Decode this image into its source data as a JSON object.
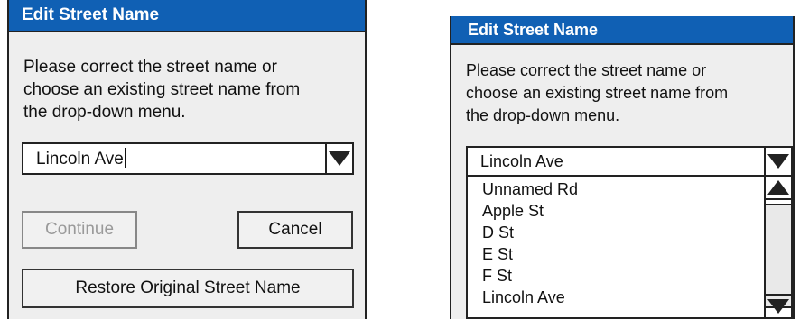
{
  "left_dialog": {
    "title": "Edit Street Name",
    "message_lines": [
      "Please correct the street name or",
      "choose an existing street name from",
      "the drop-down menu."
    ],
    "street_input_value": "Lincoln Ave",
    "dropdown_arrow_icon": "triangle-down",
    "continue_label": "Continue",
    "cancel_label": "Cancel",
    "restore_label": "Restore Original Street Name"
  },
  "right_dialog": {
    "title": "Edit Street Name",
    "message_lines": [
      "Please correct the street name or",
      "choose an existing street name from",
      "the drop-down menu."
    ],
    "selected_value": "Lincoln Ave",
    "dropdown_arrow_icon": "triangle-down",
    "options": [
      "Unnamed Rd",
      "Apple St",
      "D St",
      "E St",
      "F St",
      "Lincoln Ave"
    ],
    "scroll_up_icon": "triangle-up",
    "scroll_down_icon": "triangle-down"
  },
  "colors": {
    "titlebar": "#1060b4",
    "dialog_bg": "#eeeeee",
    "disabled_text": "#9a9a9a"
  }
}
